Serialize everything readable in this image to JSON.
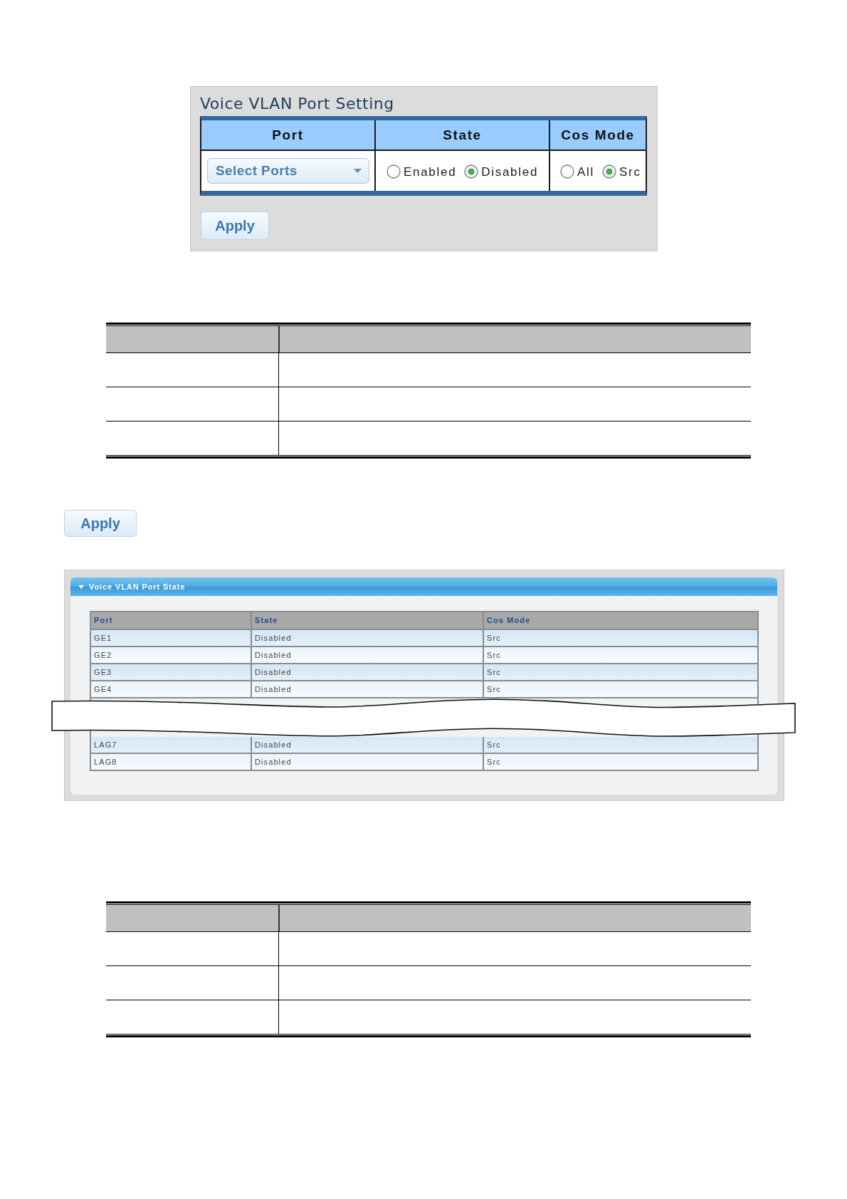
{
  "settings_panel": {
    "title": "Voice VLAN Port Setting",
    "columns": [
      "Port",
      "State",
      "Cos Mode"
    ],
    "port_select": {
      "value": "Select Ports"
    },
    "state_options": [
      {
        "label": "Enabled",
        "selected": false
      },
      {
        "label": "Disabled",
        "selected": true
      }
    ],
    "cos_mode_options": [
      {
        "label": "All",
        "selected": false
      },
      {
        "label": "Src",
        "selected": true
      }
    ],
    "apply_button": "Apply"
  },
  "apply_button": "Apply",
  "state_panel": {
    "title": "Voice VLAN Port State",
    "expanded": true,
    "columns": [
      "Port",
      "State",
      "Cos Mode"
    ],
    "rows_above_break": [
      {
        "port": "GE1",
        "state": "Disabled",
        "cos_mode": "Src"
      },
      {
        "port": "GE2",
        "state": "Disabled",
        "cos_mode": "Src"
      },
      {
        "port": "GE3",
        "state": "Disabled",
        "cos_mode": "Src"
      },
      {
        "port": "GE4",
        "state": "Disabled",
        "cos_mode": "Src"
      }
    ],
    "rows_below_break": [
      {
        "port": "LAG7",
        "state": "Disabled",
        "cos_mode": "Src"
      },
      {
        "port": "LAG8",
        "state": "Disabled",
        "cos_mode": "Src"
      }
    ]
  }
}
